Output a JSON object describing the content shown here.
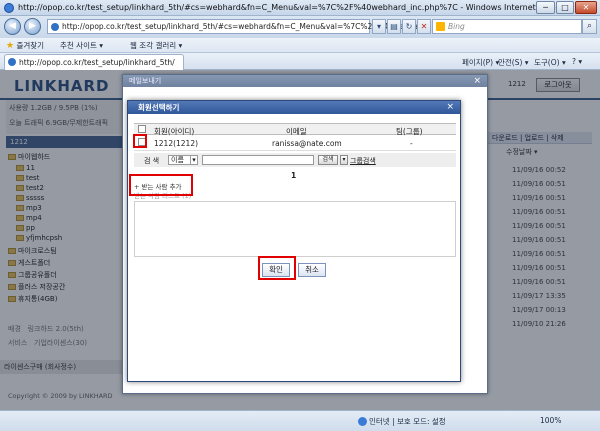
{
  "window": {
    "title": "http://opop.co.kr/test_setup/linkhard_5th/#cs=webhard&fn=C_Menu&val=%7C%2F%40webhard_inc.php%7C - Windows Internet Explorer",
    "min": "─",
    "max": "□",
    "close": "✕"
  },
  "toolbar": {
    "back": "◀",
    "forward": "▶",
    "address": "http://opop.co.kr/test_setup/linkhard_5th/#cs=webhard&fn=C_Menu&val=%7C%2F%40webhard_inc.php%7C",
    "search_placeholder": "Bing",
    "search_go": "⌕"
  },
  "favorites": {
    "fav_label": "즐겨찾기",
    "suggested": "추천 사이트 ▾",
    "gallery": "웹 조각 갤러리 ▾"
  },
  "tab": {
    "label": "http://opop.co.kr/test_setup/linkhard_5th/"
  },
  "commands": {
    "page": "페이지(P) ▾",
    "safety": "안전(S) ▾",
    "tools": "도구(O) ▾",
    "help": "? ▾"
  },
  "page": {
    "logo": "LINKHARD",
    "user_id": "1212",
    "logout": "로그아웃",
    "usage": "사용량 1.2GB / 9.5PB (1%)",
    "traffic": "오늘 트래픽 6.9GB/무제한트래픽",
    "sidebar_head": "1212",
    "tree": [
      "마이웹하드",
      "11",
      "test",
      "test2",
      "sssss",
      "mp3",
      "mp4",
      "pp",
      "yfjmhcpsh",
      "마이크로스팀",
      "게스트폴더",
      "그룹공유폴더",
      "플러스 저장공간",
      "휴지통(4GB)"
    ],
    "extra_rows": [
      {
        "label": "배경",
        "value": "링크하드 2.0(5th)"
      },
      {
        "label": "서비스",
        "value": "기업라이센스(30)"
      }
    ],
    "bottom_bar": "라이센스구매 (회사정수)",
    "copyright": "Copyright © 2009 by LINKHARD",
    "right_head": "다운로드 | 업로드 | 삭제",
    "right_sub": "수정날짜 ▾",
    "dates": [
      "11/09/16 00:52",
      "11/09/16 00:51",
      "11/09/16 00:51",
      "11/09/16 00:51",
      "11/09/16 00:51",
      "11/09/16 00:51",
      "11/09/16 00:51",
      "11/09/16 00:51",
      "11/09/16 00:51",
      "11/09/17 13:35",
      "11/09/17 00:13",
      "11/09/10 21:26"
    ]
  },
  "modal_outer": {
    "title": "메일보내기",
    "close": "×"
  },
  "modal_inner": {
    "title": "회원선택하기",
    "close": "×",
    "columns": [
      "회원(아이디)",
      "이메일",
      "팀(그룹)"
    ],
    "rows": [
      {
        "member": "1212(1212)",
        "email": "ranissa@nate.com",
        "group": "-"
      }
    ],
    "search_label": "검 색",
    "search_option": "이름",
    "search_btn": "검색",
    "group_search": "그룹검색",
    "page": "1",
    "add_people": "+ 받는 사람 추가",
    "add_hint": "받는 사람 리스트 (1)",
    "ok": "확인",
    "cancel": "취소"
  },
  "statusbar": {
    "zone": "인터넷 | 보호 모드: 설정",
    "zoom": "100%"
  },
  "colors": {
    "highlight": "#e00000",
    "inner_title": "#2f5699",
    "brand": "#2b4f80"
  }
}
